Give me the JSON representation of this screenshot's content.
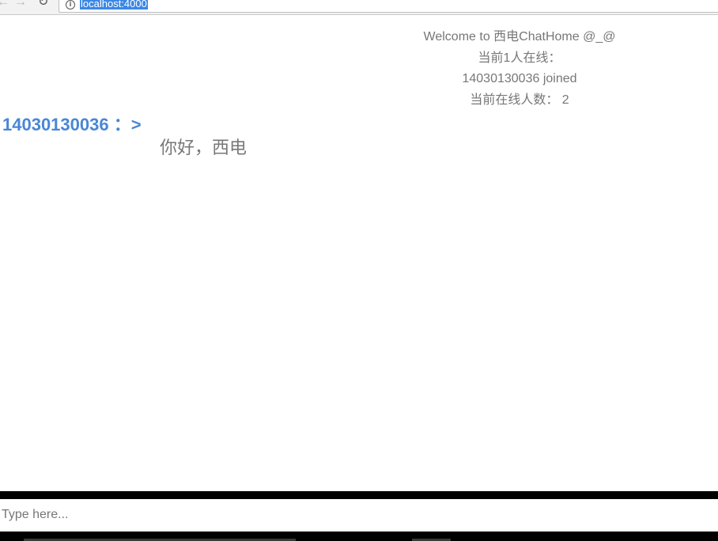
{
  "browser": {
    "back_icon": "arrow-left-icon",
    "forward_icon": "arrow-right-icon",
    "reload_icon": "reload-icon",
    "info_icon": "info-icon",
    "url": "localhost:4000"
  },
  "header": {
    "welcome": "Welcome to 西电ChatHome @_@",
    "online_label": "当前1人在线：",
    "join_notice": "14030130036 joined",
    "online_count_text": "当前在线人数： 2"
  },
  "messages": [
    {
      "sender_line": "14030130036 ：>",
      "text": "你好，西电"
    }
  ],
  "composer": {
    "placeholder": "Type here..."
  },
  "colors": {
    "sender": "#4a86d6",
    "text_gray": "#777777",
    "url_highlight": "#3b87e6",
    "divider": "#000000"
  }
}
